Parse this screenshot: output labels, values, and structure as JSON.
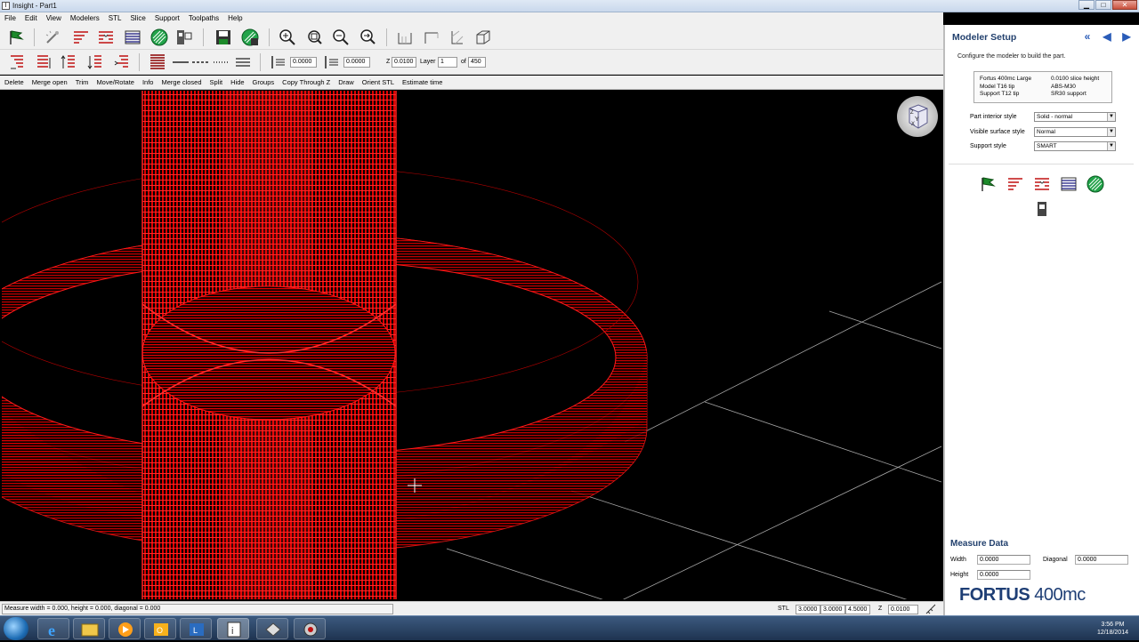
{
  "window": {
    "title": "Insight - Part1",
    "app_icon": "I"
  },
  "menu": [
    "File",
    "Edit",
    "View",
    "Modelers",
    "STL",
    "Slice",
    "Support",
    "Toolpaths",
    "Help"
  ],
  "toolbar2": {
    "field1": "0.0000",
    "field2": "0.0000",
    "z_label": "Z",
    "z_value": "0.0100",
    "layer_label": "Layer",
    "layer_value": "1",
    "of_label": "of",
    "of_value": "450"
  },
  "commands": [
    "Delete",
    "Merge open",
    "Trim",
    "Move/Rotate",
    "Info",
    "Merge closed",
    "Split",
    "Hide",
    "Groups",
    "Copy Through Z",
    "Draw",
    "Orient STL",
    "Estimate time"
  ],
  "status": {
    "message": "Measure width = 0.000, height = 0.000, diagonal = 0.000",
    "stl_label": "STL",
    "v1": "3.0000",
    "v2": "3.0000",
    "v3": "4.5000",
    "z_label": "Z",
    "z_value": "0.0100"
  },
  "panel": {
    "title": "Modeler Setup",
    "description": "Configure the modeler to build the part.",
    "info": {
      "r1c1": "Fortus 400mc Large",
      "r1c2": "0.0100 slice height",
      "r2c1": "Model     T16 tip",
      "r2c2": "ABS-M30",
      "r3c1": "Support   T12 tip",
      "r3c2": "SR30 support"
    },
    "interior_label": "Part interior style",
    "interior_value": "Solid - normal",
    "surface_label": "Visible surface style",
    "surface_value": "Normal",
    "support_label": "Support style",
    "support_value": "SMART",
    "measure_title": "Measure Data",
    "width_label": "Width",
    "width_value": "0.0000",
    "diagonal_label": "Diagonal",
    "diagonal_value": "0.0000",
    "height_label": "Height",
    "height_value": "0.0000",
    "brand_name": "FORTUS",
    "brand_model": "400mc"
  },
  "tray": {
    "time": "3:56 PM",
    "date": "12/18/2014"
  },
  "colors": {
    "model_red": "#ff1a1a",
    "panel_title": "#23416e",
    "grid": "#cfcfcf"
  }
}
